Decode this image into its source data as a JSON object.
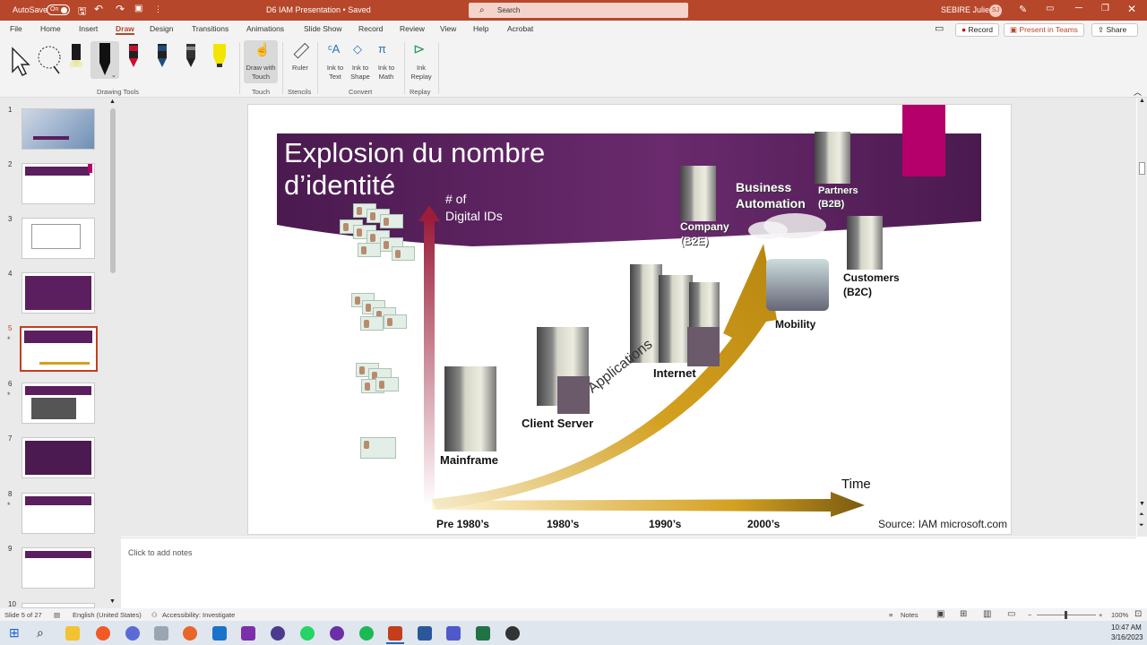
{
  "titlebar": {
    "autosave_label": "AutoSave",
    "autosave_state": "On",
    "doc_title": "D6 IAM Presentation • Saved",
    "search_placeholder": "Search",
    "user_name": "SEBIRE Julien",
    "user_initials": "SJ"
  },
  "tabs": [
    "File",
    "Home",
    "Insert",
    "Draw",
    "Design",
    "Transitions",
    "Animations",
    "Slide Show",
    "Record",
    "Review",
    "View",
    "Help",
    "Acrobat"
  ],
  "active_tab": "Draw",
  "tab_buttons": {
    "record": "Record",
    "present": "Present in Teams",
    "share": "Share"
  },
  "ribbon": {
    "groups": {
      "drawing_tools": "Drawing Tools",
      "touch": "Touch",
      "stencils": "Stencils",
      "convert": "Convert",
      "replay": "Replay"
    },
    "draw_with_touch": "Draw with Touch",
    "ruler": "Ruler",
    "ink_to_text": "Ink to Text",
    "ink_to_shape": "Ink to Shape",
    "ink_to_math": "Ink to Math",
    "ink_replay": "Ink Replay",
    "pen_colors": [
      "#1a1a1a",
      "#e8e8a0",
      "#111111",
      "#c8102e",
      "#1e4d7a",
      "#222222",
      "#f2e600"
    ]
  },
  "thumbnails": [
    {
      "num": "1",
      "star": false
    },
    {
      "num": "2",
      "star": false
    },
    {
      "num": "3",
      "star": false
    },
    {
      "num": "4",
      "star": false
    },
    {
      "num": "5",
      "star": true
    },
    {
      "num": "6",
      "star": true
    },
    {
      "num": "7",
      "star": false
    },
    {
      "num": "8",
      "star": true
    },
    {
      "num": "9",
      "star": false
    },
    {
      "num": "10",
      "star": false
    }
  ],
  "selected_slide": "5",
  "slide": {
    "title_line1": "Explosion du nombre",
    "title_line2": "d’identité",
    "y_label_line1": "# of",
    "y_label_line2": "Digital IDs",
    "x_label": "Time",
    "eras": [
      "Pre 1980’s",
      "1980’s",
      "1990’s",
      "2000’s"
    ],
    "labels": {
      "mainframe": "Mainframe",
      "client_server": "Client Server",
      "internet": "Internet",
      "applications": "Applications",
      "mobility": "Mobility",
      "business": "Business",
      "automation": "Automation",
      "company": "Company",
      "b2e": "(B2E)",
      "partners": "Partners",
      "b2b": "(B2B)",
      "customers": "Customers",
      "b2c": "(B2C)"
    },
    "source": "Source: IAM microsoft.com"
  },
  "notes_placeholder": "Click to add notes",
  "status": {
    "slide_info": "Slide 5 of 27",
    "language": "English (United States)",
    "accessibility": "Accessibility: Investigate",
    "notes": "Notes",
    "zoom": "100%"
  },
  "clock": {
    "time": "10:47 AM",
    "date": "3/16/2023"
  },
  "colors": {
    "accent": "#b7472a",
    "slide_purple": "#5b1e5e",
    "magenta": "#b5006b",
    "arrow_gold": "#d4a020"
  }
}
